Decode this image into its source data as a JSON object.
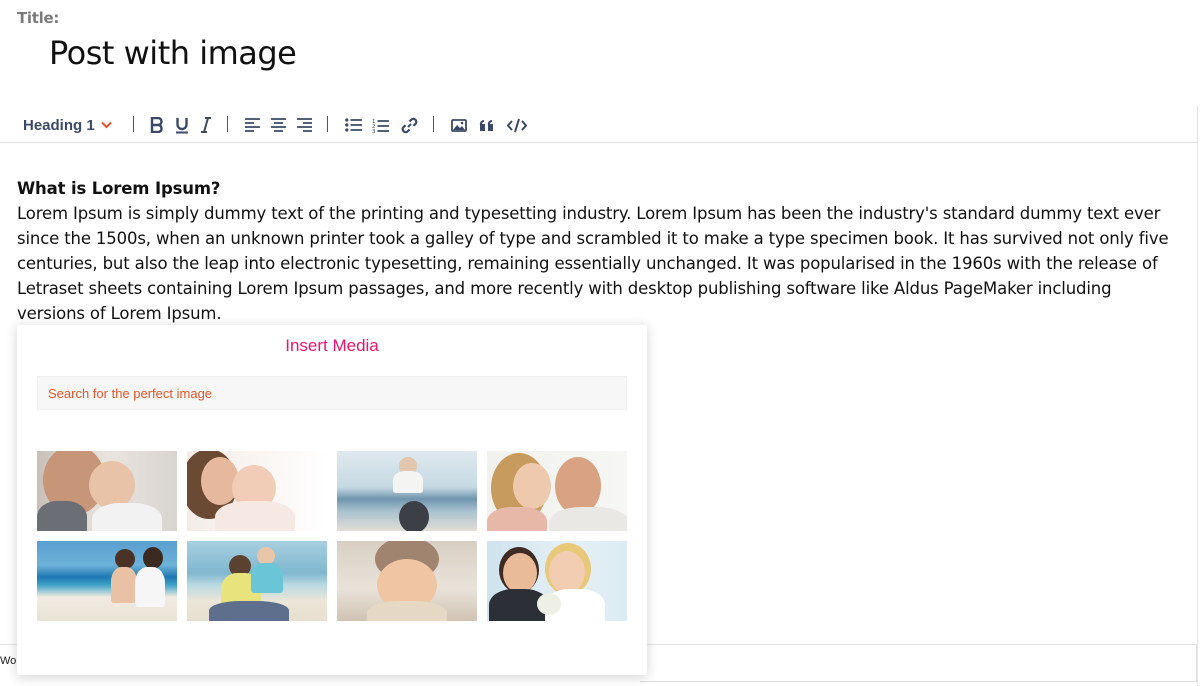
{
  "title": {
    "label": "Title:",
    "value": "Post with image"
  },
  "toolbar": {
    "heading_select": "Heading 1",
    "buttons": [
      {
        "name": "bold-icon"
      },
      {
        "name": "underline-icon"
      },
      {
        "name": "italic-icon"
      },
      {
        "name": "align-left-icon"
      },
      {
        "name": "align-center-icon"
      },
      {
        "name": "align-right-icon"
      },
      {
        "name": "bullet-list-icon"
      },
      {
        "name": "numbered-list-icon"
      },
      {
        "name": "link-icon"
      },
      {
        "name": "image-icon"
      },
      {
        "name": "quote-icon"
      },
      {
        "name": "code-icon"
      }
    ],
    "icon_color": "#3a4a66",
    "chevron_color": "#e2552b"
  },
  "content": {
    "heading": "What is Lorem Ipsum?",
    "paragraph": "Lorem Ipsum is simply dummy text of the printing and typesetting industry. Lorem Ipsum has been the industry's standard dummy text ever since the 1500s, when an unknown printer took a galley of type and scrambled it to make a type specimen book. It has survived not only five centuries, but also the leap into electronic typesetting, remaining essentially unchanged. It was popularised in the 1960s with the release of Letraset sheets containing Lorem Ipsum passages, and more recently with desktop publishing software like Aldus PageMaker including versions of Lorem Ipsum."
  },
  "media_popup": {
    "title": "Insert Media",
    "search_placeholder": "Search for the perfect image",
    "title_color": "#e8166d",
    "images": [
      {
        "name": "father-and-baby-photo"
      },
      {
        "name": "mother-and-baby-photo"
      },
      {
        "name": "child-on-beach-photo"
      },
      {
        "name": "father-and-daughter-photo"
      },
      {
        "name": "mother-and-child-beach-photo"
      },
      {
        "name": "father-and-son-beach-photo"
      },
      {
        "name": "baby-in-hat-photo"
      },
      {
        "name": "wedding-couple-photo"
      }
    ]
  },
  "footer": {
    "word_count": "Wor"
  }
}
